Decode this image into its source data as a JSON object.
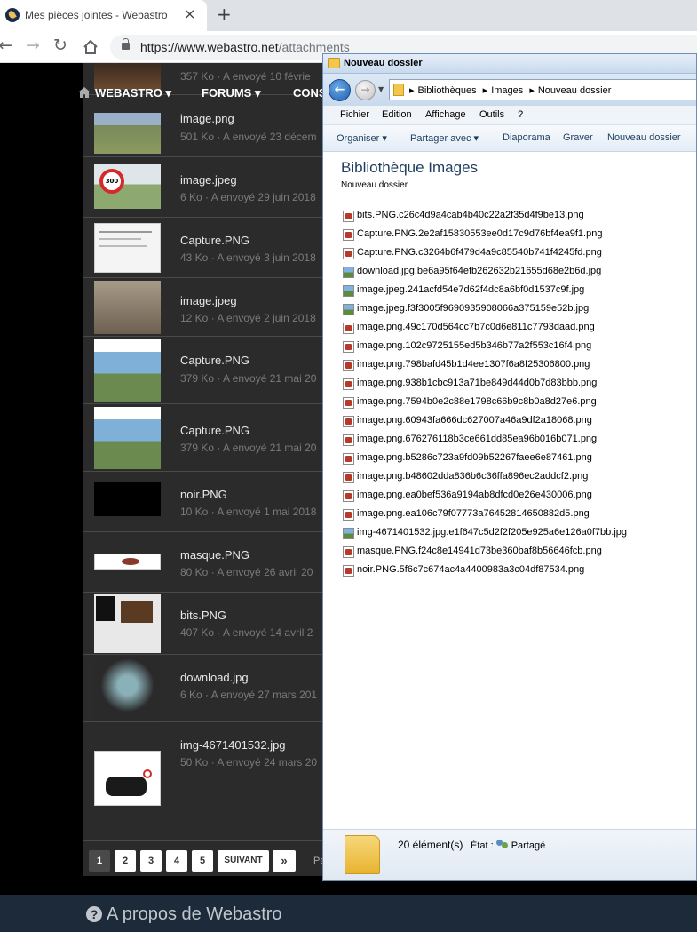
{
  "browser": {
    "tab_title": "Mes pièces jointes - Webastro",
    "tab_close": "×",
    "new_tab": "+",
    "url_host": "https://www.webastro.net",
    "url_path": "/attachments"
  },
  "webastro": {
    "nav": {
      "brand": "WEBASTRO ▾",
      "forums": "FORUMS ▾",
      "cons": "CONS"
    },
    "attachments": [
      {
        "name": "",
        "meta": "357 Ko · A envoyé 10 févrie"
      },
      {
        "name": "image.png",
        "meta": "501 Ko · A envoyé 23 décem"
      },
      {
        "name": "image.jpeg",
        "meta": "6 Ko · A envoyé 29 juin 2018"
      },
      {
        "name": "Capture.PNG",
        "meta": "43 Ko · A envoyé 3 juin 2018"
      },
      {
        "name": "image.jpeg",
        "meta": "12 Ko · A envoyé 2 juin 2018"
      },
      {
        "name": "Capture.PNG",
        "meta": "379 Ko · A envoyé 21 mai 20"
      },
      {
        "name": "Capture.PNG",
        "meta": "379 Ko · A envoyé 21 mai 20"
      },
      {
        "name": "noir.PNG",
        "meta": "10 Ko · A envoyé 1 mai 2018"
      },
      {
        "name": "masque.PNG",
        "meta": "80 Ko · A envoyé 26 avril 20"
      },
      {
        "name": "bits.PNG",
        "meta": "407 Ko · A envoyé 14 avril 2"
      },
      {
        "name": "download.jpg",
        "meta": "6 Ko · A envoyé 27 mars 201"
      },
      {
        "name": "img-4671401532.jpg",
        "meta": "50 Ko · A envoyé 24 mars 20"
      }
    ],
    "pager": {
      "p1": "1",
      "p2": "2",
      "p3": "3",
      "p4": "4",
      "p5": "5",
      "next": "SUIVANT",
      "last": "»",
      "trailing": "Pa"
    },
    "footer": {
      "about": "A propos de Webastro"
    }
  },
  "explorer": {
    "title": "Nouveau dossier",
    "address": {
      "seg1": "Bibliothèques",
      "seg2": "Images",
      "seg3": "Nouveau dossier"
    },
    "menu": {
      "fichier": "Fichier",
      "edition": "Edition",
      "affichage": "Affichage",
      "outils": "Outils",
      "help": "?"
    },
    "commands": {
      "organiser": "Organiser ▾",
      "partager": "Partager avec ▾",
      "diaporama": "Diaporama",
      "graver": "Graver",
      "nouveau": "Nouveau dossier"
    },
    "library_title": "Bibliothèque Images",
    "library_subtitle": "Nouveau dossier",
    "files": [
      {
        "name": "bits.PNG.c26c4d9a4cab4b40c22a2f35d4f9be13.png",
        "kind": "png"
      },
      {
        "name": "Capture.PNG.2e2af15830553ee0d17c9d76bf4ea9f1.png",
        "kind": "png"
      },
      {
        "name": "Capture.PNG.c3264b6f479d4a9c85540b741f4245fd.png",
        "kind": "png"
      },
      {
        "name": "download.jpg.be6a95f64efb262632b21655d68e2b6d.jpg",
        "kind": "jpg"
      },
      {
        "name": "image.jpeg.241acfd54e7d62f4dc8a6bf0d1537c9f.jpg",
        "kind": "jpg"
      },
      {
        "name": "image.jpeg.f3f3005f9690935908066a375159e52b.jpg",
        "kind": "jpg"
      },
      {
        "name": "image.png.49c170d564cc7b7c0d6e811c7793daad.png",
        "kind": "png"
      },
      {
        "name": "image.png.102c9725155ed5b346b77a2f553c16f4.png",
        "kind": "png"
      },
      {
        "name": "image.png.798bafd45b1d4ee1307f6a8f25306800.png",
        "kind": "png"
      },
      {
        "name": "image.png.938b1cbc913a71be849d44d0b7d83bbb.png",
        "kind": "png"
      },
      {
        "name": "image.png.7594b0e2c88e1798c66b9c8b0a8d27e6.png",
        "kind": "png"
      },
      {
        "name": "image.png.60943fa666dc627007a46a9df2a18068.png",
        "kind": "png"
      },
      {
        "name": "image.png.676276118b3ce661dd85ea96b016b071.png",
        "kind": "png"
      },
      {
        "name": "image.png.b5286c723a9fd09b52267faee6e87461.png",
        "kind": "png"
      },
      {
        "name": "image.png.b48602dda836b6c36ffa896ec2addcf2.png",
        "kind": "png"
      },
      {
        "name": "image.png.ea0bef536a9194ab8dfcd0e26e430006.png",
        "kind": "png"
      },
      {
        "name": "image.png.ea106c79f07773a76452814650882d5.png",
        "kind": "png"
      },
      {
        "name": "img-4671401532.jpg.e1f647c5d2f2f205e925a6e126a0f7bb.jpg",
        "kind": "jpg"
      },
      {
        "name": "masque.PNG.f24c8e14941d73be360baf8b56646fcb.png",
        "kind": "png"
      },
      {
        "name": "noir.PNG.5f6c7c674ac4a4400983a3c04df87534.png",
        "kind": "png"
      }
    ],
    "status": {
      "count": "20 élément(s)",
      "state_label": "État :",
      "state_value": "Partagé"
    }
  }
}
